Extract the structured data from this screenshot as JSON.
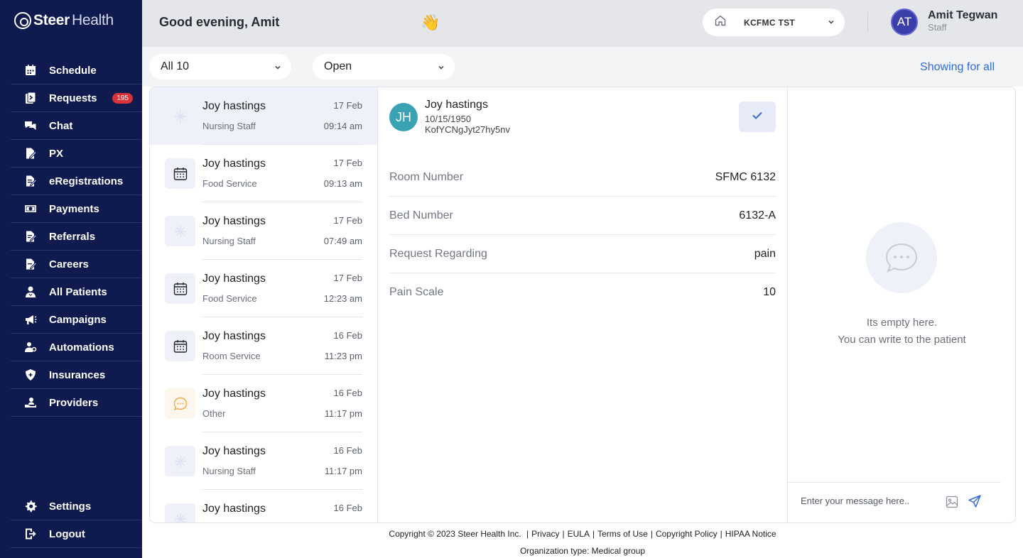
{
  "brand": {
    "name_bold": "Steer",
    "name_light": "Health"
  },
  "sidebar": {
    "items": [
      {
        "label": "Schedule",
        "icon": "calendar-icon"
      },
      {
        "label": "Requests",
        "icon": "requests-icon",
        "badge": "195"
      },
      {
        "label": "Chat",
        "icon": "chat-icon"
      },
      {
        "label": "PX",
        "icon": "px-icon"
      },
      {
        "label": "eRegistrations",
        "icon": "registration-icon"
      },
      {
        "label": "Payments",
        "icon": "payment-icon"
      },
      {
        "label": "Referrals",
        "icon": "referral-icon"
      },
      {
        "label": "Careers",
        "icon": "careers-icon"
      },
      {
        "label": "All Patients",
        "icon": "patients-icon"
      },
      {
        "label": "Campaigns",
        "icon": "megaphone-icon"
      },
      {
        "label": "Automations",
        "icon": "automation-icon"
      },
      {
        "label": "Insurances",
        "icon": "insurance-icon"
      },
      {
        "label": "Providers",
        "icon": "provider-icon"
      }
    ],
    "bottom": [
      {
        "label": "Settings",
        "icon": "gear-icon"
      },
      {
        "label": "Logout",
        "icon": "logout-icon"
      }
    ]
  },
  "header": {
    "greeting": "Good evening, Amit",
    "wave": "👋",
    "facility": "KCFMC TST",
    "user": {
      "initials": "AT",
      "name": "Amit Tegwan",
      "role": "Staff"
    }
  },
  "filters": {
    "count_filter": "All 10",
    "status_filter": "Open",
    "showing": "Showing for all"
  },
  "requests": [
    {
      "name": "Joy hastings",
      "dept": "Nursing Staff",
      "date": "17 Feb",
      "time": "09:14 am",
      "icon": "nursing-icon",
      "selected": true
    },
    {
      "name": "Joy hastings",
      "dept": "Food Service",
      "date": "17 Feb",
      "time": "09:13 am",
      "icon": "calendar-icon"
    },
    {
      "name": "Joy hastings",
      "dept": "Nursing Staff",
      "date": "17 Feb",
      "time": "07:49 am",
      "icon": "nursing-icon"
    },
    {
      "name": "Joy hastings",
      "dept": "Food Service",
      "date": "17 Feb",
      "time": "12:23 am",
      "icon": "calendar-icon"
    },
    {
      "name": "Joy hastings",
      "dept": "Room Service",
      "date": "16 Feb",
      "time": "11:23 pm",
      "icon": "calendar-icon"
    },
    {
      "name": "Joy hastings",
      "dept": "Other",
      "date": "16 Feb",
      "time": "11:17 pm",
      "icon": "chat-bubble-icon"
    },
    {
      "name": "Joy hastings",
      "dept": "Nursing Staff",
      "date": "16 Feb",
      "time": "11:17 pm",
      "icon": "nursing-icon"
    },
    {
      "name": "Joy hastings",
      "dept": "",
      "date": "16 Feb",
      "time": "",
      "icon": "nursing-icon"
    }
  ],
  "detail": {
    "initials": "JH",
    "name": "Joy hastings",
    "dob": "10/15/1950",
    "patient_id": "KofYCNgJyt27hy5nv",
    "fields": [
      {
        "label": "Room Number",
        "value": "SFMC 6132"
      },
      {
        "label": "Bed Number",
        "value": "6132-A"
      },
      {
        "label": "Request Regarding",
        "value": "pain"
      },
      {
        "label": "Pain Scale",
        "value": "10"
      }
    ]
  },
  "chat": {
    "empty_line1": "Its empty here.",
    "empty_line2": "You can write to the patient",
    "placeholder": "Enter your message here.."
  },
  "footer": {
    "copyright": "Copyright © 2023 Steer Health Inc.",
    "links": [
      "Privacy",
      "EULA",
      "Terms of Use",
      "Copyright Policy",
      "HIPAA Notice"
    ],
    "org": "Organization type: Medical group"
  },
  "colors": {
    "sidebar_bg": "#0f1a4f",
    "accent": "#2f6bd8",
    "badge": "#d9323a",
    "patient_avatar": "#3aa3b3"
  }
}
